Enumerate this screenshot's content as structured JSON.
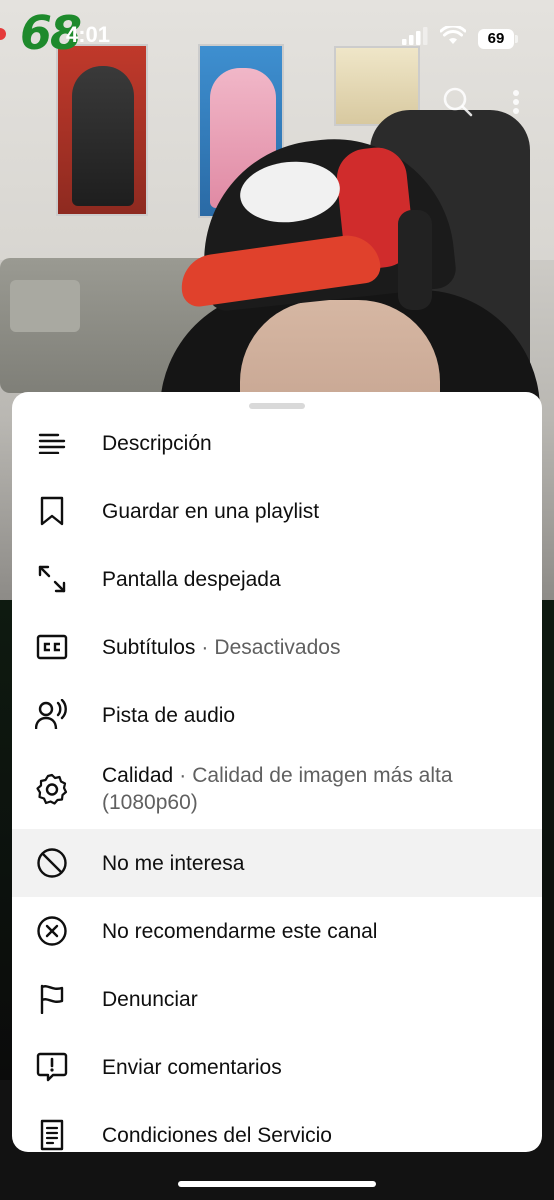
{
  "status_bar": {
    "time": "4:01",
    "battery": "69",
    "icons": [
      "signal-icon",
      "wifi-icon",
      "battery-icon"
    ]
  },
  "video": {
    "overlay_text": "68",
    "top_icons": [
      "search-icon",
      "more-vert-icon"
    ]
  },
  "menu": {
    "items": [
      {
        "label": "Descripción",
        "icon": "description-icon"
      },
      {
        "label": "Guardar en una playlist",
        "icon": "bookmark-icon"
      },
      {
        "label": "Pantalla despejada",
        "icon": "expand-icon"
      },
      {
        "label": "Subtítulos",
        "sub": "Desactivados",
        "icon": "closed-captions-icon"
      },
      {
        "label": "Pista de audio",
        "icon": "audio-track-icon"
      },
      {
        "label": "Calidad",
        "sub": "Calidad de imagen más alta (1080p60)",
        "icon": "settings-gear-icon"
      },
      {
        "label": "No me interesa",
        "icon": "not-interested-icon"
      },
      {
        "label": "No recomendarme este canal",
        "icon": "block-channel-icon"
      },
      {
        "label": "Denunciar",
        "icon": "flag-icon"
      },
      {
        "label": "Enviar comentarios",
        "icon": "feedback-icon"
      },
      {
        "label": "Condiciones del Servicio",
        "icon": "terms-icon"
      }
    ],
    "separator": "·"
  },
  "colors": {
    "sheet_bg": "#ffffff",
    "text_primary": "#0f0f0f",
    "text_secondary": "#606060",
    "highlight_row": "#f2f2f2"
  }
}
